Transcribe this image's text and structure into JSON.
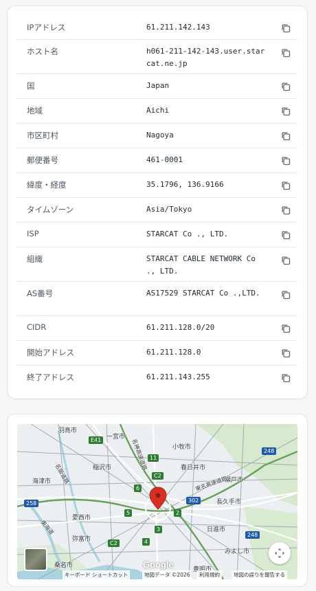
{
  "rows": [
    {
      "label": "IPアドレス",
      "value": "61.211.142.143"
    },
    {
      "label": "ホスト名",
      "value": "h061-211-142-143.user.starcat.ne.jp"
    },
    {
      "label": "国",
      "value": "Japan"
    },
    {
      "label": "地域",
      "value": "Aichi"
    },
    {
      "label": "市区町村",
      "value": "Nagoya"
    },
    {
      "label": "郵便番号",
      "value": "461-0001"
    },
    {
      "label": "緯度・経度",
      "value": "35.1796, 136.9166"
    },
    {
      "label": "タイムゾーン",
      "value": "Asia/Tokyo"
    },
    {
      "label": "ISP",
      "value": "STARCAT Co ., LTD."
    },
    {
      "label": "組織",
      "value": "STARCAT CABLE NETWORK Co ., LTD."
    },
    {
      "label": "AS番号",
      "value": "AS17529 STARCAT Co .,LTD."
    },
    {
      "label": "CIDR",
      "value": "61.211.128.0/20"
    },
    {
      "label": "開始アドレス",
      "value": "61.211.128.0"
    },
    {
      "label": "終了アドレス",
      "value": "61.211.143.255"
    }
  ],
  "map": {
    "places": {
      "hashima": "羽島市",
      "ichinomiya": "一宮市",
      "komaki": "小牧市",
      "inazawa": "稲沢市",
      "kasugai": "春日井市",
      "kaizu": "海津市",
      "seto": "瀬戸市",
      "aisai": "愛西市",
      "nagakute": "長久手市",
      "yatomi": "弥富市",
      "nisshin": "日進市",
      "kuwana": "桑名市",
      "miyoshi": "みよし市",
      "toyoake": "豊明市"
    },
    "roads": {
      "e41": "E41",
      "r11": "11",
      "c2a": "C2",
      "r6": "6",
      "r302": "302",
      "r248a": "248",
      "r258": "258",
      "r5": "5",
      "r2": "2",
      "r3": "3",
      "r4": "4",
      "c2b": "C2",
      "r248b": "248"
    },
    "road_names": {
      "meishin": "名神高速道路",
      "tomei": "東名高速道路",
      "meihan": "名阪道路",
      "tokai": "東海道"
    },
    "google": "Google",
    "attribution": {
      "keyboard": "キーボード ショートカット",
      "data": "地図データ ©2026",
      "terms": "利用規約",
      "report": "地図の誤りを報告する"
    }
  },
  "colors": {
    "accent_pin": "#d93025",
    "highway": "#2e7d32",
    "border": "#dde3ea"
  }
}
